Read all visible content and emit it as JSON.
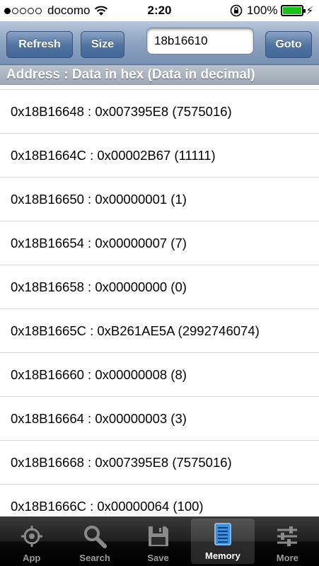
{
  "status": {
    "carrier": "docomo",
    "time": "2:20",
    "battery": "100%",
    "signal_bars_filled": 1,
    "signal_bars_total": 5
  },
  "toolbar": {
    "refresh_label": "Refresh",
    "size_label": "Size",
    "address_value": "18b16610",
    "goto_label": "Goto"
  },
  "header": {
    "title": "Address : Data in hex (Data in decimal)"
  },
  "rows": [
    "0x18B16648 : 0x007395E8 (7575016)",
    "0x18B1664C : 0x00002B67 (11111)",
    "0x18B16650 : 0x00000001 (1)",
    "0x18B16654 : 0x00000007 (7)",
    "0x18B16658 : 0x00000000 (0)",
    "0x18B1665C : 0xB261AE5A (2992746074)",
    "0x18B16660 : 0x00000008 (8)",
    "0x18B16664 : 0x00000003 (3)",
    "0x18B16668 : 0x007395E8 (7575016)",
    "0x18B1666C : 0x00000064 (100)"
  ],
  "tabs": [
    {
      "label": "App",
      "icon": "crosshair-icon",
      "active": false
    },
    {
      "label": "Search",
      "icon": "magnifier-icon",
      "active": false
    },
    {
      "label": "Save",
      "icon": "floppy-disk-icon",
      "active": false
    },
    {
      "label": "Memory",
      "icon": "memory-list-icon",
      "active": true
    },
    {
      "label": "More",
      "icon": "sliders-icon",
      "active": false
    }
  ],
  "colors": {
    "toolbar": "#8da3c0",
    "button": "#4f72a0",
    "battery": "#19c219",
    "active_tab_icon": "#3f8fe0"
  }
}
